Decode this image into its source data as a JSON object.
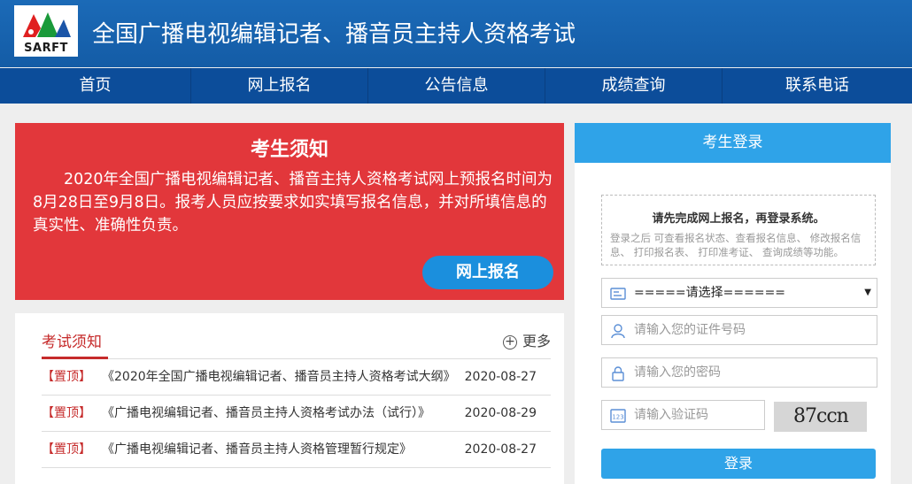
{
  "header": {
    "logo_text": "SARFT",
    "title": "全国广播电视编辑记者、播音员主持人资格考试",
    "bg_color": "#1b6ab7"
  },
  "nav": {
    "items": [
      {
        "label": "首页"
      },
      {
        "label": "网上报名"
      },
      {
        "label": "公告信息"
      },
      {
        "label": "成绩查询"
      },
      {
        "label": "联系电话"
      }
    ]
  },
  "notice": {
    "title": "考生须知",
    "text": "2020年全国广播电视编辑记者、播音主持人资格考试网上预报名时间为8月28日至9月8日。报考人员应按要求如实填写报名信息，并对所填信息的真实性、准确性负责。",
    "button_label": "网上报名",
    "bg_color": "#e2373b",
    "button_color": "#1b8fdd"
  },
  "news": {
    "title": "考试须知",
    "more_label": "更多",
    "items": [
      {
        "tag": "【置顶】",
        "title": "《2020年全国广播电视编辑记者、播音员主持人资格考试大纲》",
        "date": "2020-08-27"
      },
      {
        "tag": "【置顶】",
        "title": "《广播电视编辑记者、播音员主持人资格考试办法（试行）》",
        "date": "2020-08-29"
      },
      {
        "tag": "【置顶】",
        "title": "《广播电视编辑记者、播音员主持人资格管理暂行规定》",
        "date": "2020-08-27"
      }
    ],
    "accent_color": "#c62b2b"
  },
  "login": {
    "title": "考生登录",
    "tip_main": "请先完成网上报名，再登录系统。",
    "tip_sub": "登录之后 可查看报名状态、查看报名信息、 修改报名信息、 打印报名表、 打印准考证、 查询成绩等功能。",
    "select_value": "=====请选择======",
    "id_placeholder": "请输入您的证件号码",
    "password_placeholder": "请输入您的密码",
    "captcha_placeholder": "请输入验证码",
    "captcha_text": "87ccn",
    "submit_label": "登录",
    "accent_color": "#2fa3e8"
  }
}
